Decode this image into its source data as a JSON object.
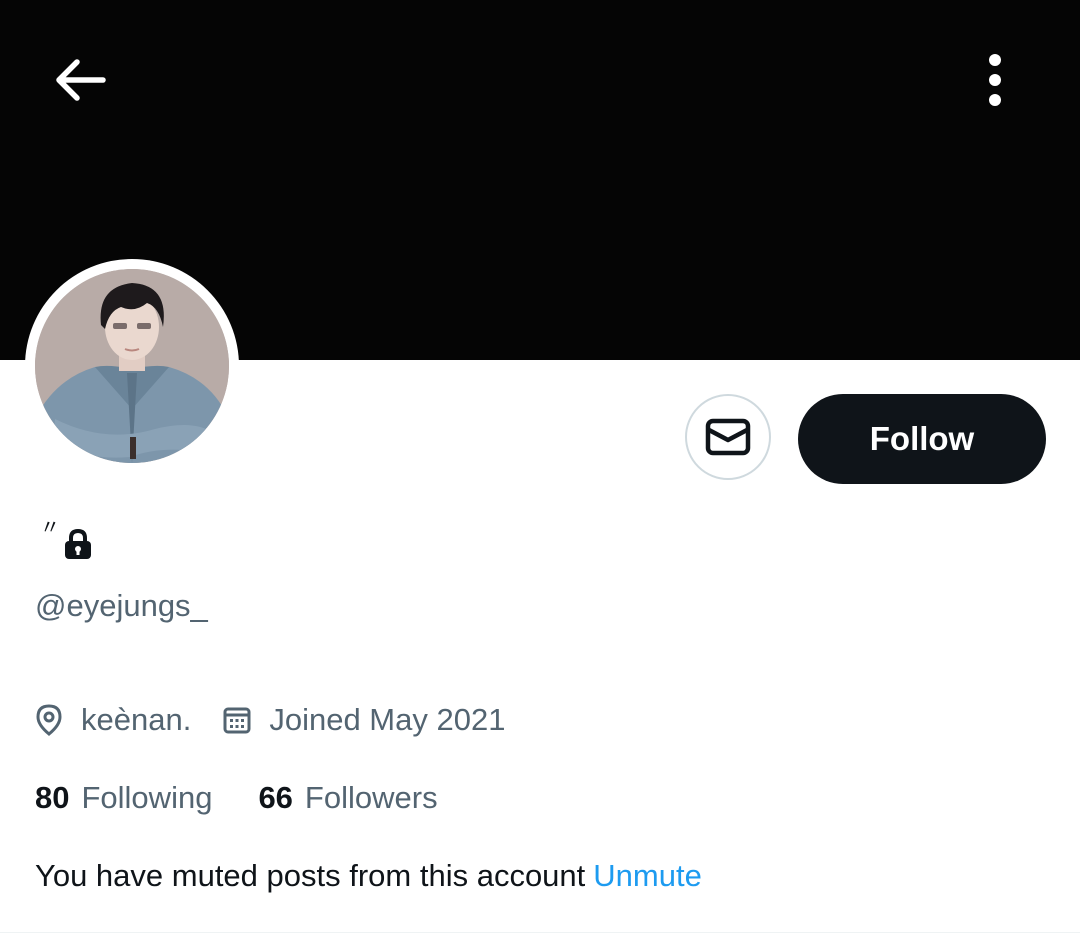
{
  "header": {
    "back_icon": "arrow-left-icon",
    "more_icon": "more-vertical-icon",
    "banner_color": "#050505"
  },
  "profile": {
    "name_mark": "〃",
    "lock_icon": "lock-icon",
    "handle": "@eyejungs_",
    "location": "keènan.",
    "joined": "Joined May 2021"
  },
  "actions": {
    "message_icon": "mail-icon",
    "follow_label": "Follow"
  },
  "stats": {
    "following_count": "80",
    "following_label": "Following",
    "followers_count": "66",
    "followers_label": "Followers"
  },
  "muted": {
    "text": "You have muted posts from this account",
    "link": "Unmute",
    "link_color": "#1d9bf0"
  }
}
